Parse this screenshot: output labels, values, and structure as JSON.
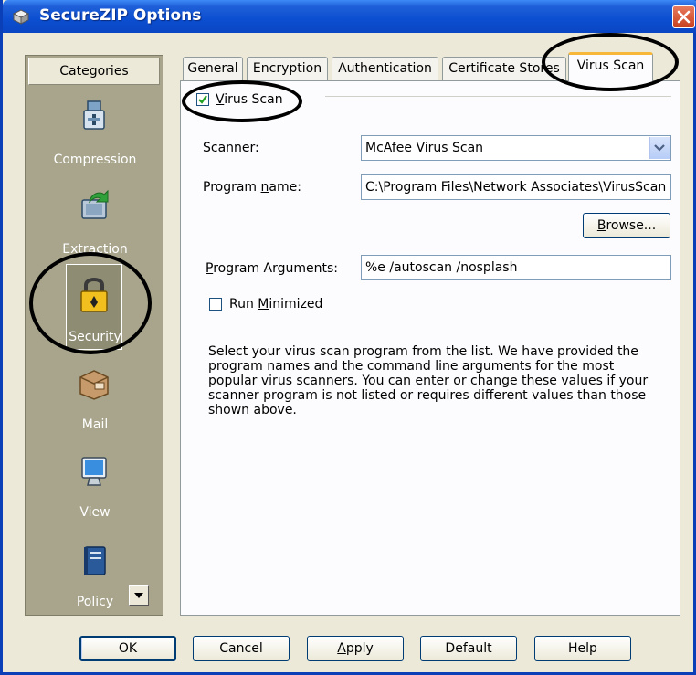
{
  "window": {
    "title": "SecureZIP Options",
    "close_icon": "close-icon"
  },
  "sidebar": {
    "header": "Categories",
    "items": [
      {
        "label": "Compression",
        "icon": "compression-icon"
      },
      {
        "label": "Extraction",
        "icon": "extraction-icon"
      },
      {
        "label": "Security",
        "icon": "padlock-icon",
        "selected": true
      },
      {
        "label": "Mail",
        "icon": "mail-icon"
      },
      {
        "label": "View",
        "icon": "monitor-icon"
      },
      {
        "label": "Policy",
        "icon": "policy-book-icon"
      }
    ]
  },
  "tabs": [
    {
      "label": "General"
    },
    {
      "label": "Encryption"
    },
    {
      "label": "Authentication"
    },
    {
      "label": "Certificate Stores"
    },
    {
      "label": "Virus Scan",
      "active": true
    }
  ],
  "virus_scan": {
    "group_label": "Virus Scan",
    "enabled": true,
    "scanner_label": "Scanner:",
    "scanner_value": "McAfee Virus Scan",
    "program_name_label": "Program name:",
    "program_name_value": "C:\\Program Files\\Network Associates\\VirusScan",
    "browse_label": "Browse...",
    "program_arguments_label": "Program Arguments:",
    "program_arguments_value": "%e /autoscan /nosplash",
    "run_minimized_label": "Run Minimized",
    "run_minimized": false,
    "description": "Select your virus scan program from the list. We have provided the program names and the command line arguments for the most popular virus scanners. You can enter or change these values if your scanner program is not listed or requires different values than those shown above."
  },
  "buttons": {
    "ok": "OK",
    "cancel": "Cancel",
    "apply": "Apply",
    "default": "Default",
    "help": "Help"
  },
  "colors": {
    "titlebar": "#0a46c4",
    "sidebar": "#a8a58c",
    "active_tab_accent": "#f7b83a",
    "checkmark": "#21a121"
  }
}
